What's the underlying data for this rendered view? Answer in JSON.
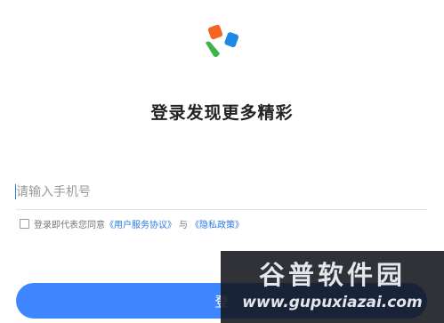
{
  "header": {
    "title": "登录发现更多精彩"
  },
  "phone_field": {
    "placeholder": "请输入手机号",
    "value": ""
  },
  "agreement": {
    "prefix": "登录即代表您同意",
    "user_agreement": "《用户服务协议》",
    "joiner": "与",
    "privacy_policy": "《隐私政策》"
  },
  "login_button": {
    "label": "登"
  },
  "watermark": {
    "line1": "谷普软件园",
    "line2": "www.gupuxiazai.com"
  },
  "colors": {
    "accent": "#3f87ff",
    "link": "#2a7ae2",
    "logo_orange": "#f26522",
    "logo_blue": "#1e88e5",
    "logo_green": "#3bb54a"
  },
  "icons": {
    "logo": "app-logo-icon",
    "checkbox": "checkbox-unchecked-icon"
  }
}
